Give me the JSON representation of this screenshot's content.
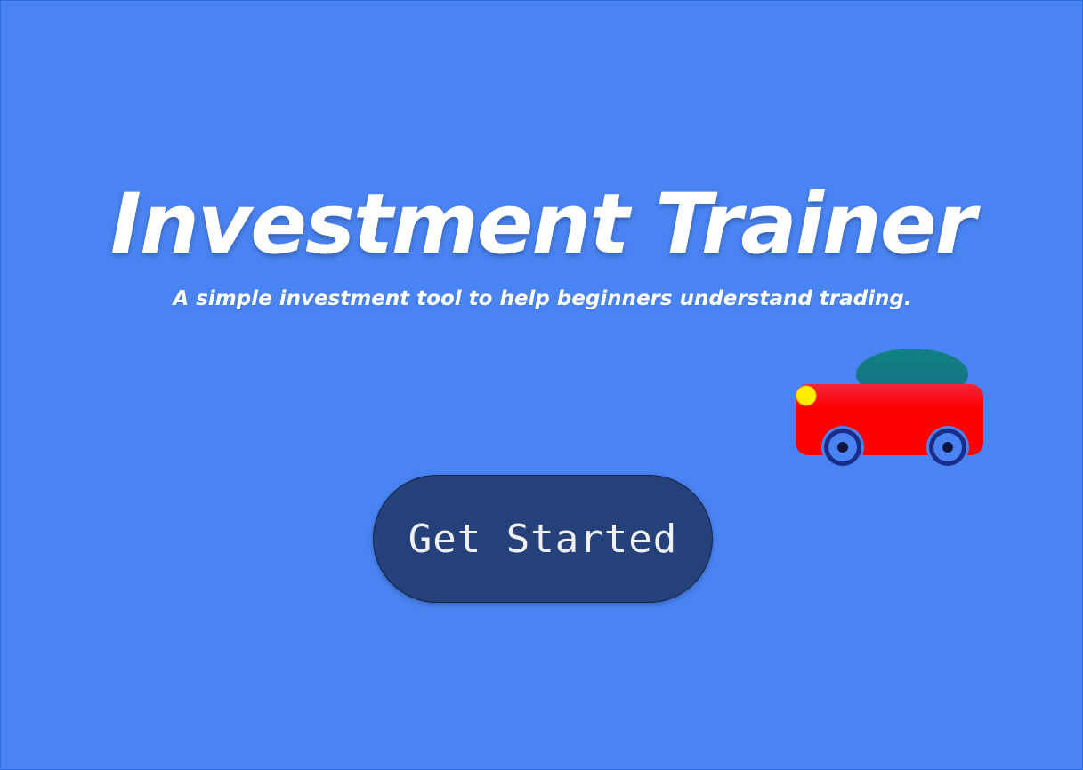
{
  "hero": {
    "title": "Investment Trainer",
    "subtitle": "A simple investment tool to help beginners understand trading."
  },
  "cta": {
    "label": "Get Started"
  },
  "illustration": {
    "name": "car-icon",
    "colors": {
      "background": "#4a84f3",
      "car_body": "#ff0000",
      "car_roof": "#0f8182",
      "headlight": "#ffee00",
      "wheel": "#1a2d8a",
      "button": "#25417a"
    }
  }
}
